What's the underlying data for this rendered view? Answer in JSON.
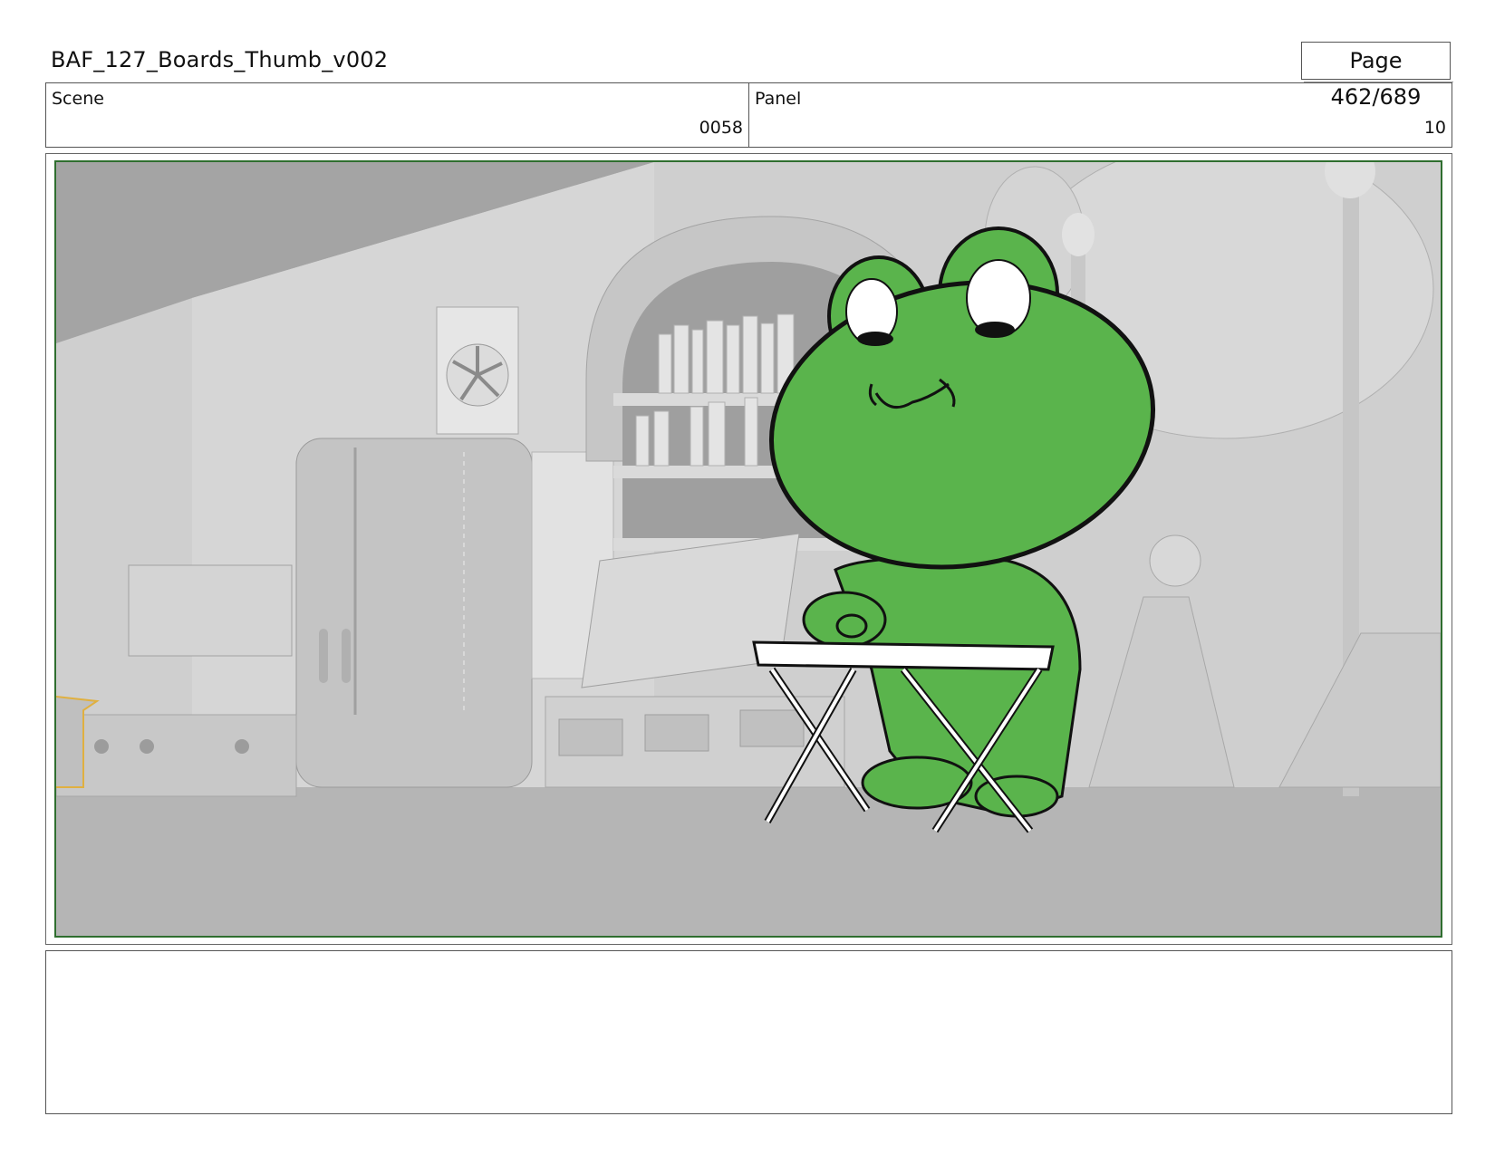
{
  "header": {
    "document_title": "BAF_127_Boards_Thumb_v002",
    "page_label": "Page 462/689"
  },
  "meta": {
    "scene": {
      "label": "Scene",
      "value": "0058"
    },
    "panel": {
      "label": "Panel",
      "value": "10"
    }
  },
  "colors": {
    "frame_border": "#2f6e2f",
    "character_green": "#5ab44c",
    "set_grey": "#cfcfcf"
  },
  "notes": {
    "text": ""
  }
}
